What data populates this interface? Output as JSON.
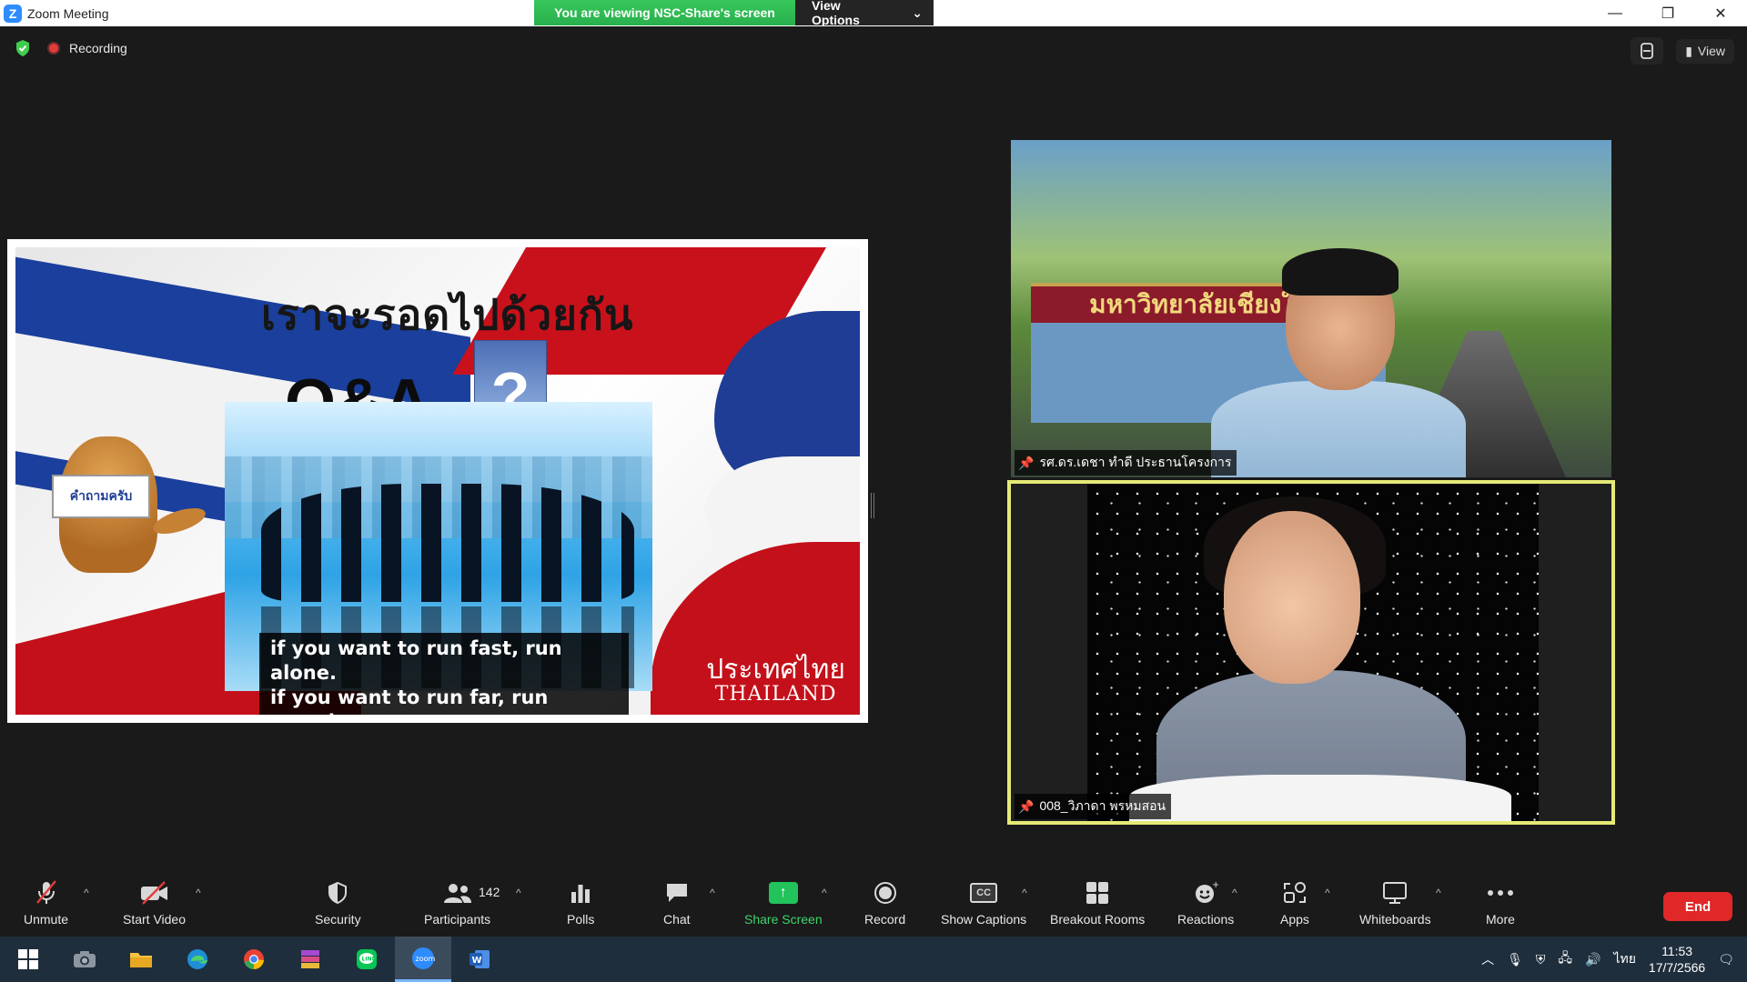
{
  "window": {
    "title": "Zoom Meeting",
    "share_banner": "You are viewing NSC-Share's screen",
    "view_options": "View Options",
    "minimize": "—",
    "restore": "❐",
    "close": "✕"
  },
  "meeting": {
    "recording_label": "Recording",
    "view_button": "View"
  },
  "slide": {
    "title": "เราจะรอดไปด้วยกัน",
    "qa": "Q&A",
    "question_mark": "?",
    "quote_line1": "if you want to run fast, run alone.",
    "quote_line2": "if you want to run far, run together.",
    "dog_sign": "คำถามครับ",
    "logo_thai": "ประเทศไทย",
    "logo_en": "THAILAND",
    "university_sign": "มหาวิทยาลัยเชียงใหม่"
  },
  "participants_tiles": [
    {
      "name": "รศ.ดร.เดชา ทำดี ประธานโครงการ"
    },
    {
      "name": "008_วิภาดา พรหมสอน"
    }
  ],
  "toolbar": {
    "unmute": "Unmute",
    "start_video": "Start Video",
    "security": "Security",
    "participants": "Participants",
    "participants_count": "142",
    "polls": "Polls",
    "chat": "Chat",
    "share_screen": "Share Screen",
    "record": "Record",
    "show_captions": "Show Captions",
    "cc": "CC",
    "breakout_rooms": "Breakout Rooms",
    "reactions": "Reactions",
    "apps": "Apps",
    "whiteboards": "Whiteboards",
    "more": "More",
    "end": "End"
  },
  "taskbar": {
    "language": "ไทย",
    "time": "11:53",
    "date": "17/7/2566"
  },
  "colors": {
    "zoom_blue": "#2d8cff",
    "share_green": "#29b04d",
    "end_red": "#e02828",
    "active_speaker": "#e5ea77"
  }
}
